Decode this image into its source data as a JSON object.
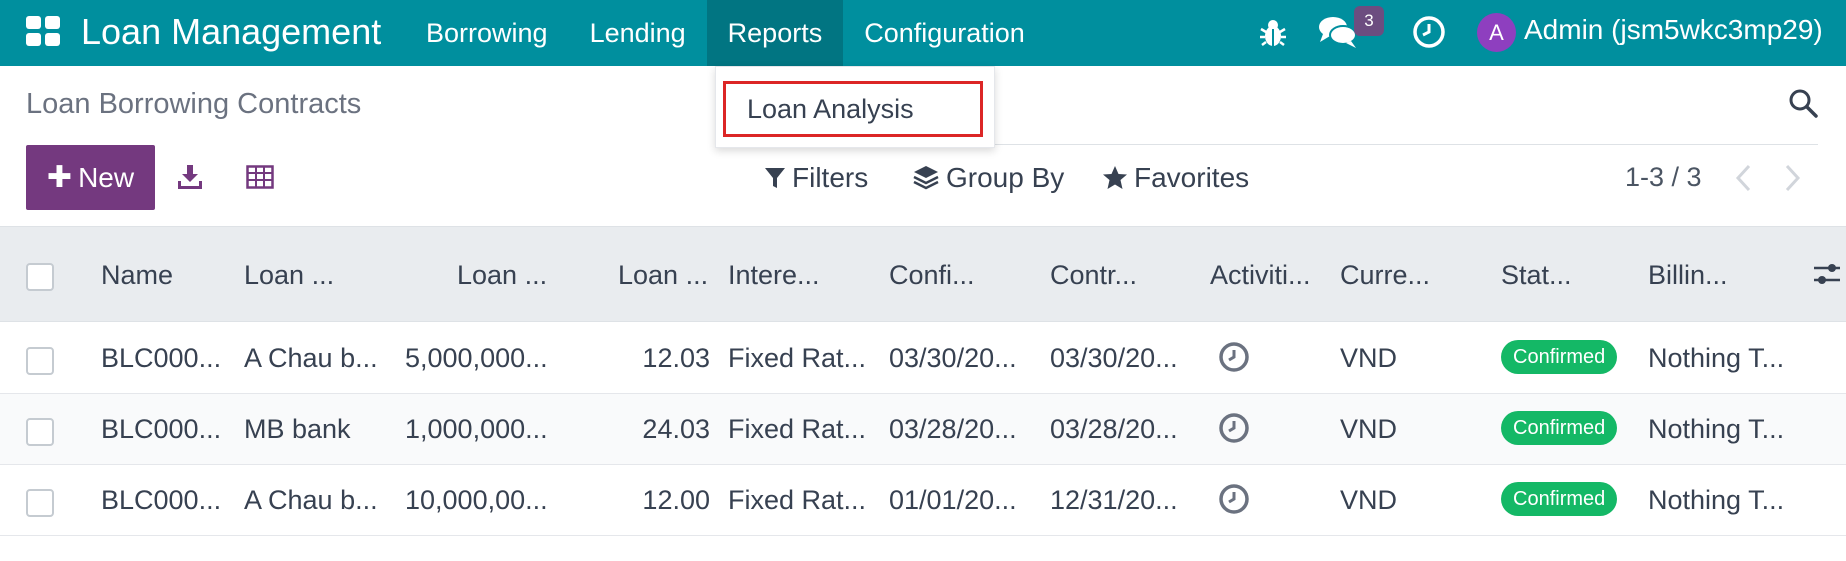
{
  "app": {
    "title": "Loan Management",
    "menu": [
      "Borrowing",
      "Lending",
      "Reports",
      "Configuration"
    ],
    "active_menu": "Reports",
    "chat_count": "3",
    "user_initial": "A",
    "user_name": "Admin (jsm5wkc3mp29)"
  },
  "icons": {
    "apps": "apps-grid-icon",
    "debug": "bug-icon",
    "messages": "chat-icon",
    "activities": "clock-icon",
    "search": "search-icon",
    "download": "download-icon",
    "table": "table-icon",
    "filter": "funnel-icon",
    "group": "layers-icon",
    "favorite": "star-icon",
    "column_settings": "sliders-icon"
  },
  "colors": {
    "navbar": "#008f9e",
    "primary": "#74397f",
    "success": "#14b866",
    "highlight": "#dc2626"
  },
  "reports_menu": {
    "items": [
      "Loan Analysis"
    ]
  },
  "control": {
    "breadcrumb": "Loan Borrowing Contracts",
    "new_label": "New",
    "filters_label": "Filters",
    "group_by_label": "Group By",
    "favorites_label": "Favorites",
    "pager": "1-3 / 3"
  },
  "table": {
    "columns": [
      "Name",
      "Loan ...",
      "Loan ...",
      "Loan ...",
      "Intere...",
      "Confi...",
      "Contr...",
      "Activiti...",
      "Curre...",
      "Stat...",
      "Billin..."
    ],
    "rows": [
      {
        "name": "BLC000...",
        "partner": "A Chau b...",
        "amount": "5,000,000...",
        "rate": "12.03",
        "interest": "Fixed Rat...",
        "confirm_date": "03/30/20...",
        "contract_date": "03/30/20...",
        "currency": "VND",
        "status": "Confirmed",
        "billing": "Nothing T..."
      },
      {
        "name": "BLC000...",
        "partner": "MB bank",
        "amount": "1,000,000...",
        "rate": "24.03",
        "interest": "Fixed Rat...",
        "confirm_date": "03/28/20...",
        "contract_date": "03/28/20...",
        "currency": "VND",
        "status": "Confirmed",
        "billing": "Nothing T..."
      },
      {
        "name": "BLC000...",
        "partner": "A Chau b...",
        "amount": "10,000,00...",
        "rate": "12.00",
        "interest": "Fixed Rat...",
        "confirm_date": "01/01/20...",
        "contract_date": "12/31/20...",
        "currency": "VND",
        "status": "Confirmed",
        "billing": "Nothing T..."
      }
    ]
  }
}
